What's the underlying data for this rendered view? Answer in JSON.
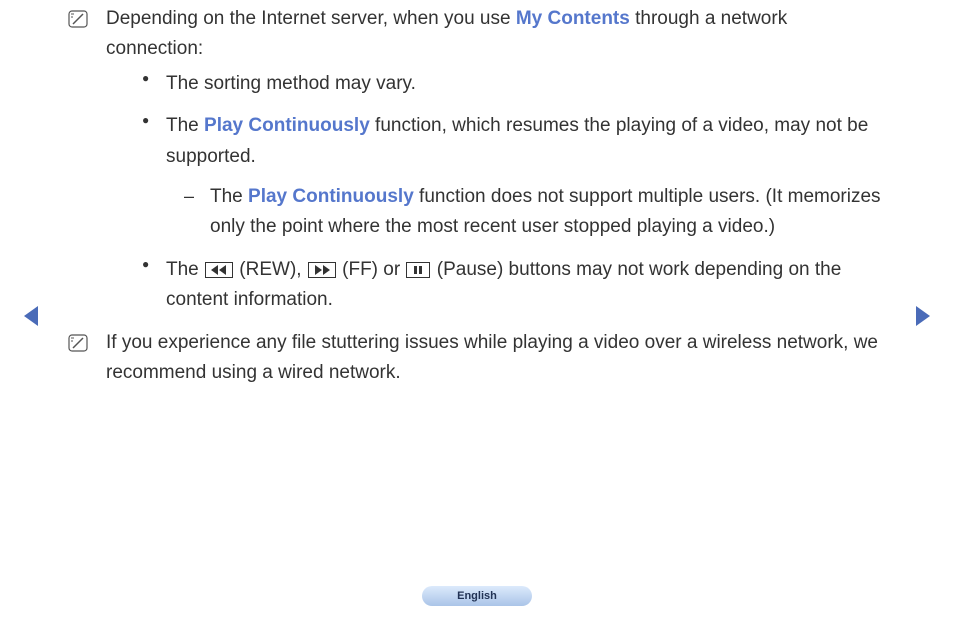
{
  "note1": {
    "intro_prefix": "Depending on the Internet server, when you use ",
    "intro_highlight": "My Contents",
    "intro_suffix": " through a network connection:",
    "bullets": {
      "b1": "The sorting method may vary.",
      "b2_prefix": "The ",
      "b2_highlight": "Play Continuously",
      "b2_suffix": " function, which resumes the playing of a video, may not be supported.",
      "b2_sub_prefix": "The ",
      "b2_sub_highlight": "Play Continuously",
      "b2_sub_suffix": " function does not support multiple users. (It memorizes only the point where the most recent user stopped playing a video.)",
      "b3_p1": "The ",
      "b3_rew": " (REW), ",
      "b3_ff": " (FF) or ",
      "b3_pause": " (Pause) buttons may not work depending on the content information."
    }
  },
  "note2": {
    "text": "If you experience any file stuttering issues while playing a video over a wireless network, we recommend using a wired network."
  },
  "language": "English"
}
